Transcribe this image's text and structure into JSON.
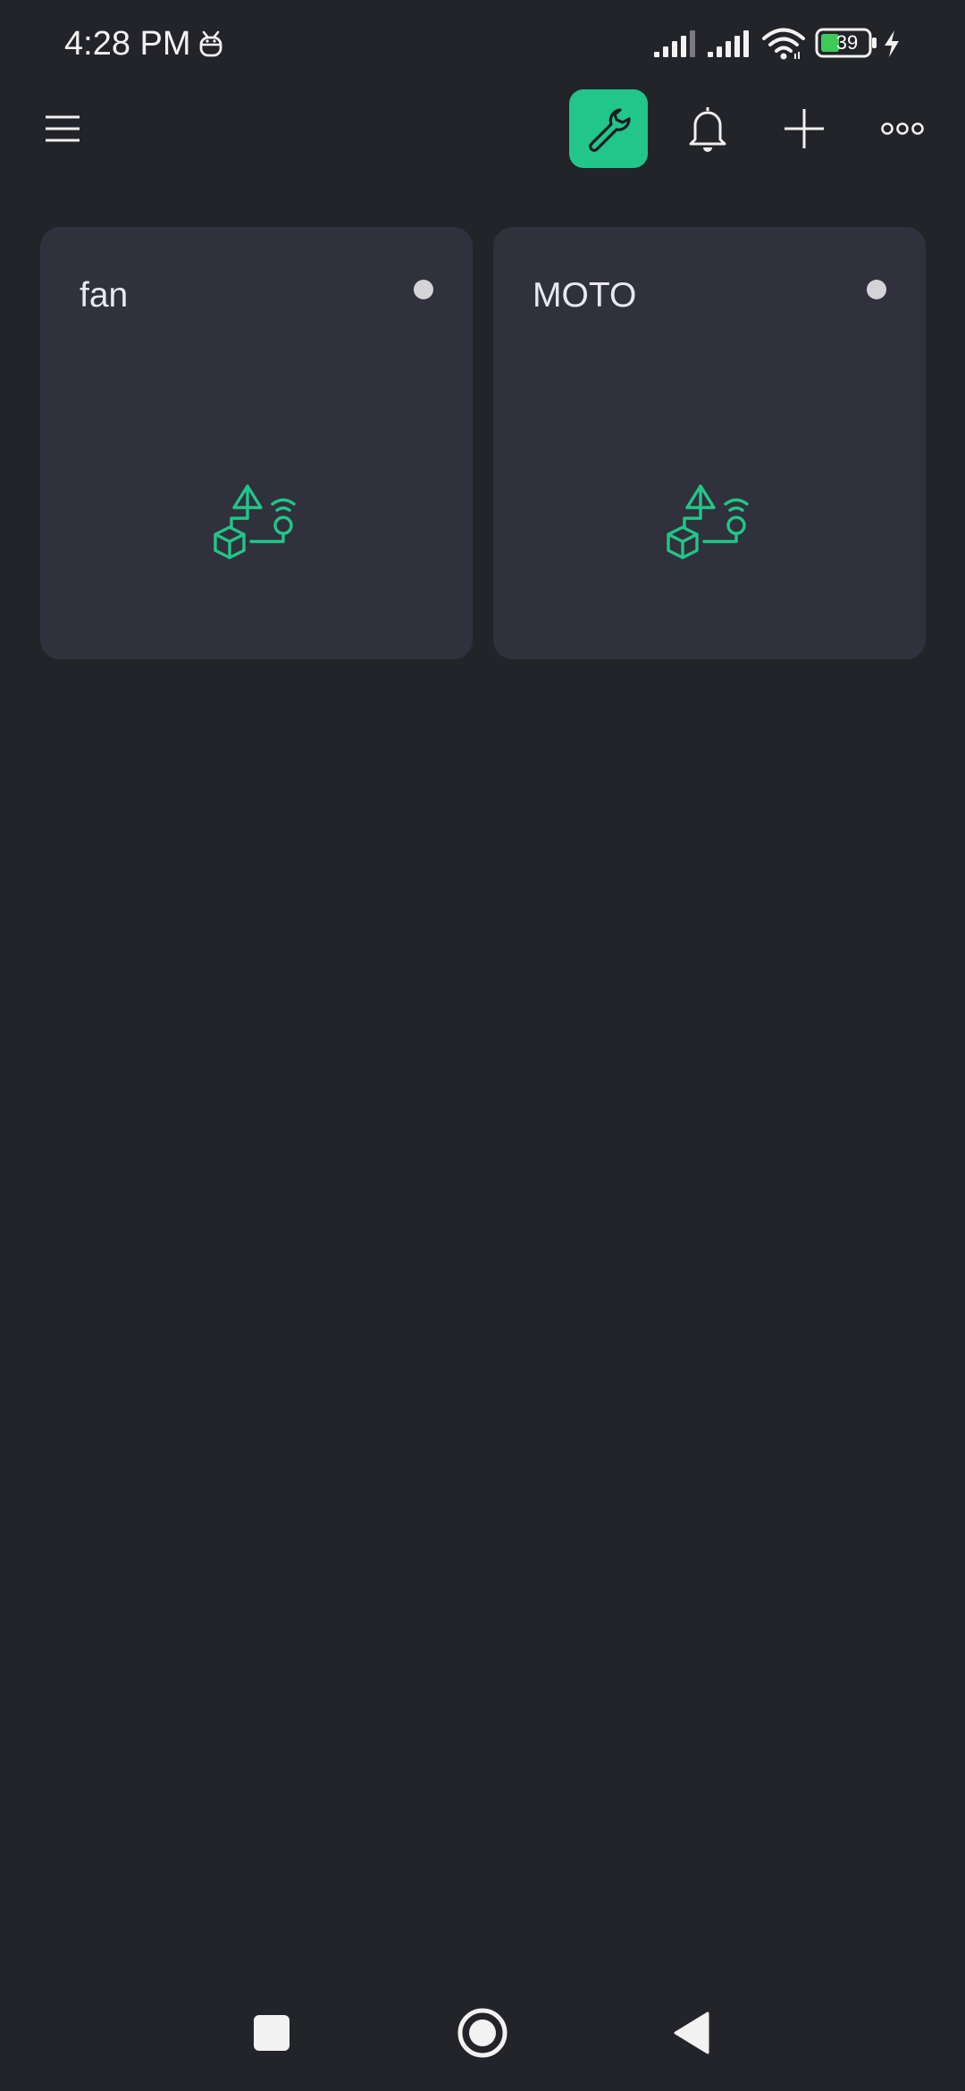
{
  "status_bar": {
    "time": "4:28 PM",
    "battery_level": "39",
    "icons": [
      "robot-notification-icon",
      "cell-signal-icon",
      "cell-signal-icon",
      "wifi-icon",
      "battery-icon",
      "charging-bolt-icon"
    ]
  },
  "app_bar": {
    "icons": [
      "menu-icon",
      "wrench-icon",
      "bell-icon",
      "plus-icon",
      "more-icon"
    ],
    "accent_color": "#22c58a"
  },
  "devices": [
    {
      "name": "fan",
      "icon": "device-template-icon",
      "status_color": "#d4d4d8"
    },
    {
      "name": "MOTO",
      "icon": "device-template-icon",
      "status_color": "#d4d4d8"
    }
  ],
  "nav_bar": {
    "icons": [
      "recents-square-icon",
      "home-circle-icon",
      "back-triangle-icon"
    ]
  },
  "colors": {
    "background": "#232429",
    "card": "#30313c",
    "accent": "#22c58a"
  }
}
